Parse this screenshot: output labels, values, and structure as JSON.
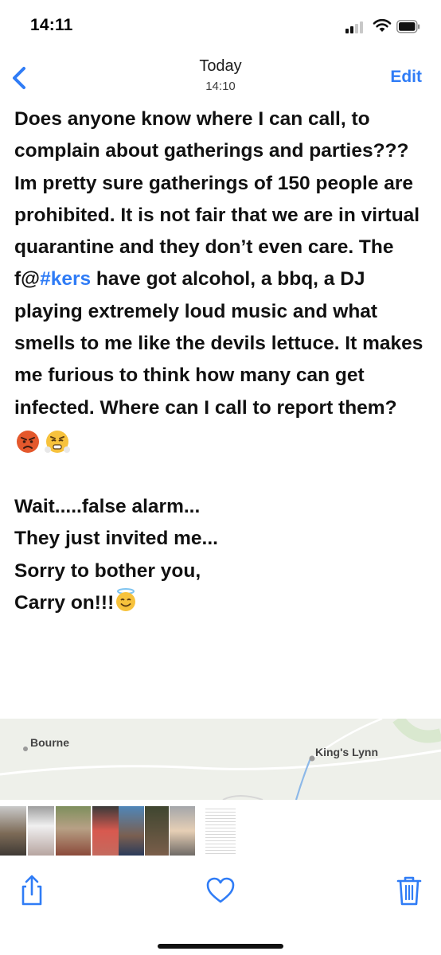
{
  "status_bar": {
    "time": "14:11"
  },
  "nav": {
    "day": "Today",
    "time": "14:10",
    "edit_label": "Edit"
  },
  "note": {
    "line_1": "Does anyone know where I can call, to complain about gatherings and parties???",
    "line_2_before": "Im pretty sure gatherings of 150 people are prohibited. It is not fair that we are in virtual quarantine and they don’t even care. The f@",
    "hashtag": "#kers",
    "line_2_after": " have got alcohol, a bbq, a DJ playing extremely loud music and what smells to me like the devils lettuce. It makes me furious to think how many can get infected. Where can I call to report them?",
    "emojis": [
      "😡",
      "😤"
    ],
    "line_3": "Wait.....false alarm...",
    "line_4": "They just invited me...",
    "line_5": "Sorry to bother you,",
    "line_6": "Carry on!!!",
    "line_6_emoji": "😇"
  },
  "map": {
    "place_1": "Bourne",
    "place_2": "King's Lynn"
  },
  "colors": {
    "accent": "#2f7cf6",
    "text": "#111111",
    "map_bg": "#eef0ea"
  },
  "toolbar": {
    "icons": [
      "share-icon",
      "heart-icon",
      "trash-icon"
    ]
  }
}
